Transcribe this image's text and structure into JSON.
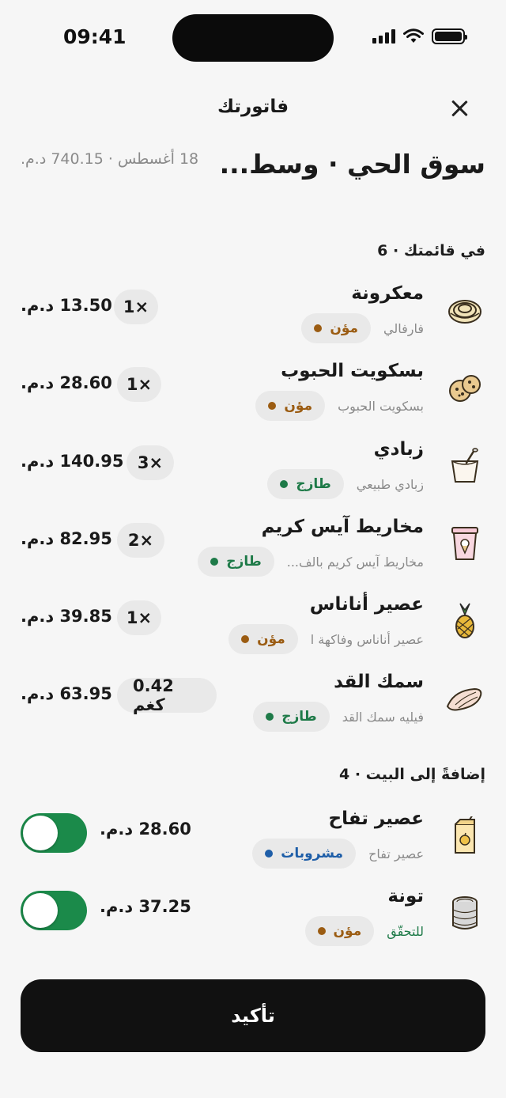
{
  "status_bar": {
    "time": "09:41"
  },
  "header": {
    "title": "فاتورتك"
  },
  "store": {
    "name": "سوق الحي · وسط...",
    "meta": "18 أغسطس · 740.15 د.م."
  },
  "list_section": {
    "title": "في قائمتك · 6"
  },
  "list_items": [
    {
      "name": "معكرونة",
      "tag": "مؤن",
      "tag_type": "pantry",
      "desc": "فارفالي",
      "qty": "1×",
      "price": "13.50 د.م.",
      "icon": "pasta-icon"
    },
    {
      "name": "بسكويت الحبوب",
      "tag": "مؤن",
      "tag_type": "pantry",
      "desc": "بسكويت الحبوب",
      "qty": "1×",
      "price": "28.60 د.م.",
      "icon": "cookies-icon"
    },
    {
      "name": "زبادي",
      "tag": "طازج",
      "tag_type": "fresh",
      "desc": "زبادي طبيعي",
      "qty": "3×",
      "price": "140.95 د.م.",
      "icon": "yogurt-icon"
    },
    {
      "name": "مخاريط آيس كريم",
      "tag": "طازج",
      "tag_type": "fresh",
      "desc": "مخاريط آيس كريم بالف...",
      "qty": "2×",
      "price": "82.95 د.م.",
      "icon": "ice-cream-tub-icon"
    },
    {
      "name": "عصير أناناس",
      "tag": "مؤن",
      "tag_type": "pantry",
      "desc": "عصير أناناس وفاكهة ا",
      "qty": "1×",
      "price": "39.85 د.م.",
      "icon": "pineapple-icon"
    },
    {
      "name": "سمك القد",
      "tag": "طازج",
      "tag_type": "fresh",
      "desc": "فيليه سمك القد",
      "qty": "0.42 كغم",
      "price": "63.95 د.م.",
      "icon": "fish-fillet-icon"
    }
  ],
  "add_section": {
    "title": "إضافةً إلى البيت · 4"
  },
  "add_items": [
    {
      "name": "عصير تفاح",
      "tag": "مشروبات",
      "tag_type": "drinks",
      "desc": "عصير تفاح",
      "price": "28.60 د.م.",
      "enabled": true,
      "icon": "juice-box-icon"
    },
    {
      "name": "تونة",
      "tag": "مؤن",
      "tag_type": "pantry",
      "desc": "للتحقّق",
      "price": "37.25 د.م.",
      "enabled": true,
      "icon": "tuna-can-icon"
    }
  ],
  "confirm": {
    "label": "تأكيد"
  },
  "colors": {
    "pantry": "#9b5c12",
    "fresh": "#1e7a48",
    "drinks": "#1e5ea8",
    "toggle_on": "#1b8a4a",
    "button": "#111111"
  }
}
